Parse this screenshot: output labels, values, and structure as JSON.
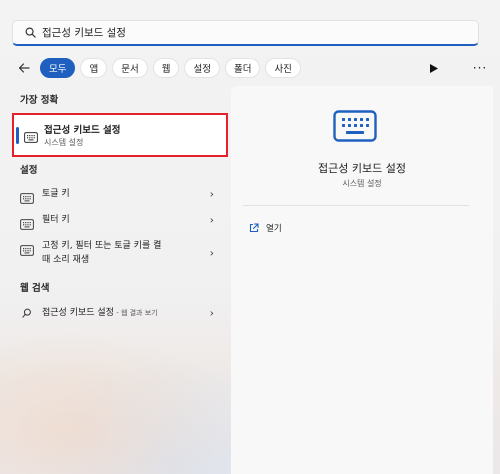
{
  "search": {
    "query": "접근성 키보드 설정"
  },
  "filters": {
    "chips": [
      {
        "label": "모두",
        "active": true
      },
      {
        "label": "앱",
        "active": false
      },
      {
        "label": "문서",
        "active": false
      },
      {
        "label": "웹",
        "active": false
      },
      {
        "label": "설정",
        "active": false
      },
      {
        "label": "폴더",
        "active": false
      },
      {
        "label": "사진",
        "active": false
      }
    ],
    "more_label": "···"
  },
  "best_match": {
    "heading": "가장 정확",
    "title": "접근성 키보드 설정",
    "subtitle": "시스템 설정"
  },
  "settings": {
    "heading": "설정",
    "items": [
      {
        "label": "토글 키"
      },
      {
        "label": "필터 키"
      },
      {
        "label_line1": "고정 키, 필터 또는 토글 키를 켤",
        "label_line2": "때 소리 재생"
      }
    ]
  },
  "web_search": {
    "heading": "웹 검색",
    "item_label": "접근성 키보드 설정",
    "item_suffix": " - 웹 결과 보기"
  },
  "preview": {
    "title": "접근성 키보드 설정",
    "subtitle": "시스템 설정",
    "open_label": "열기"
  },
  "colors": {
    "accent": "#1f5fbf",
    "highlight": "#e3212b"
  },
  "icons": {
    "search": "search-icon",
    "back": "arrow-left-icon",
    "play": "play-icon",
    "keyboard": "keyboard-icon",
    "chevron": "chevron-right-icon",
    "open": "open-external-icon"
  }
}
